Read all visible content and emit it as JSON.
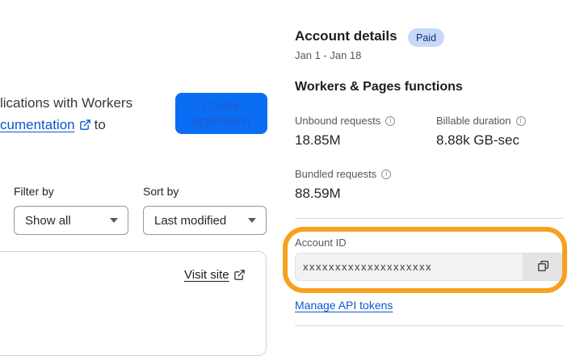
{
  "colors": {
    "link_blue": "#0a58d0",
    "button_bg": "#0b6cf4",
    "button_text": "#1c5ed0",
    "badge_bg": "#c6d9f9",
    "badge_text": "#16307a",
    "highlight_orange": "#f7a11f"
  },
  "icons": {
    "external_link": "box-with-arrow-up-right",
    "copy": "two-overlapping-squares",
    "info": "circled-i",
    "chevron_down": "down-caret-triangle"
  },
  "intro": {
    "line1": "lications with Workers",
    "link_text": "cumentation",
    "after_link": "to"
  },
  "create_button": {
    "line1": "Create",
    "line2": "application"
  },
  "filters": {
    "filter_label": "Filter by",
    "filter_value": "Show all",
    "sort_label": "Sort by",
    "sort_value": "Last modified"
  },
  "site_card": {
    "visit_link": "Visit site"
  },
  "account": {
    "title": "Account details",
    "plan_badge": "Paid",
    "date_range": "Jan 1 - Jan 18",
    "section_heading": "Workers & Pages functions",
    "stats": [
      {
        "label": "Unbound requests",
        "value": "18.85M"
      },
      {
        "label": "Billable duration",
        "value": "8.88k GB-sec"
      },
      {
        "label": "Bundled requests",
        "value": "88.59M"
      }
    ],
    "account_id_label": "Account ID",
    "account_id_value": "xxxxxxxxxxxxxxxxxxxx",
    "manage_link": "Manage API tokens"
  }
}
